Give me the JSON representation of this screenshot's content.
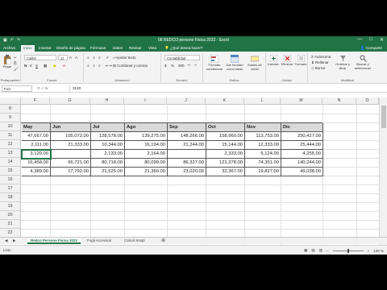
{
  "window": {
    "title": "08 REDCO persone Fisica 2022 - Excel",
    "controls": [
      "—",
      "□",
      "✕"
    ]
  },
  "tabs": [
    "Archivo",
    "Inicio",
    "Insertar",
    "Diseño de página",
    "Fórmulas",
    "Datos",
    "Revisar",
    "Vista"
  ],
  "tab_active": "Inicio",
  "tell_me": "¿Qué desea hacer?",
  "share": "Compartir",
  "ribbon": {
    "clipboard": {
      "paste": "Pegar",
      "label": "Portapapeles"
    },
    "font": {
      "name": "Calibri",
      "size": "11",
      "label": "Fuente"
    },
    "alignment": {
      "wrap": "Ajustar texto",
      "merge": "Combinar y centrar",
      "label": "Alineación"
    },
    "number": {
      "format": "Contabilidad",
      "label": "Número"
    },
    "styles": {
      "cond": "Formato condicional",
      "table": "Dar formato como tabla",
      "cell": "Estilos de celda",
      "label": "Estilos"
    },
    "cells": {
      "insert": "Insertar",
      "delete": "Eliminar",
      "format": "Formato",
      "label": "Celdas"
    },
    "editing": {
      "autosum": "Autosuma",
      "fill": "Rellenar",
      "clear": "Borrar",
      "sort": "Ordenar y filtrar",
      "find": "Buscar y seleccionar",
      "label": "Modificar"
    }
  },
  "formula_bar": {
    "name_box": "F13",
    "fx": "fx",
    "value": "3120"
  },
  "columns": [
    "F",
    "G",
    "H",
    "I",
    "J",
    "K",
    "L",
    "M",
    "N",
    "O"
  ],
  "rows": [
    "8",
    "9",
    "10",
    "11",
    "12",
    "13",
    "14",
    "15",
    "16",
    "17",
    "18",
    "19",
    "20",
    "21",
    "22"
  ],
  "table": {
    "headers": [
      "May",
      "Jun",
      "Jul",
      "Ago",
      "Sep",
      "Oct",
      "Nov",
      "Dic"
    ],
    "rows": [
      [
        "47,667.00",
        "105,072.00",
        "128,578.00",
        "139,275.00",
        "148,266.00",
        "158,960.00",
        "113,753.00",
        "250,427.00"
      ],
      [
        "2,111.00",
        "21,333.00",
        "10,344.00",
        "16,194.00",
        "21,244.00",
        "15,144.00",
        "12,333.00",
        "25,444.00"
      ],
      [
        "3,120.00",
        "",
        "2,133.00",
        "2,164.00",
        "",
        "2,333.00",
        "5,124.00",
        "4,255.00"
      ],
      [
        "16,458.00",
        "66,721.00",
        "80,718.00",
        "80,099.00",
        "86,327.00",
        "121,378.00",
        "74,351.00",
        "140,244.00"
      ],
      [
        "4,389.00",
        "17,792.00",
        "21,525.00",
        "21,360.00",
        "23,020.00",
        "32,367.00",
        "19,827.00",
        "49,038.00"
      ]
    ]
  },
  "sheets": [
    "Redco Persone Fisica 2022",
    "Fogli Accessori",
    "Calcoli Imspl"
  ],
  "active_sheet": "Redco Persone Fisica 2022",
  "status": {
    "left": "Listo",
    "zoom": "100 %"
  },
  "colors": {
    "excel_green": "#217346"
  }
}
